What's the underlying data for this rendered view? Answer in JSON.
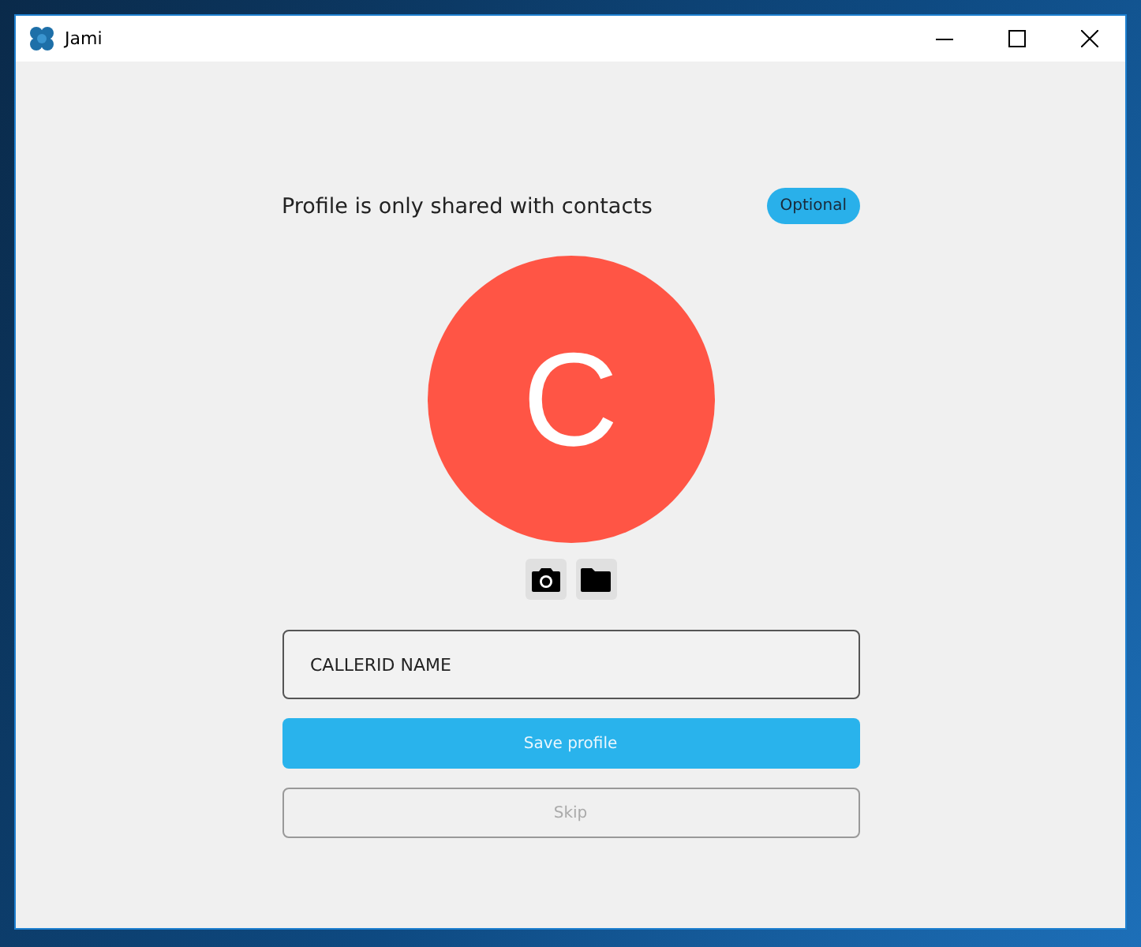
{
  "window": {
    "title": "Jami"
  },
  "profile": {
    "heading": "Profile is only shared with contacts",
    "badge": "Optional",
    "avatar": {
      "letter": "C",
      "color": "#ff5545"
    }
  },
  "name_field": {
    "value": "CALLERID NAME"
  },
  "buttons": [
    {
      "label": "Save profile",
      "kind": "primary",
      "disabled": false
    },
    {
      "label": "Skip",
      "kind": "outline",
      "disabled": true
    }
  ]
}
